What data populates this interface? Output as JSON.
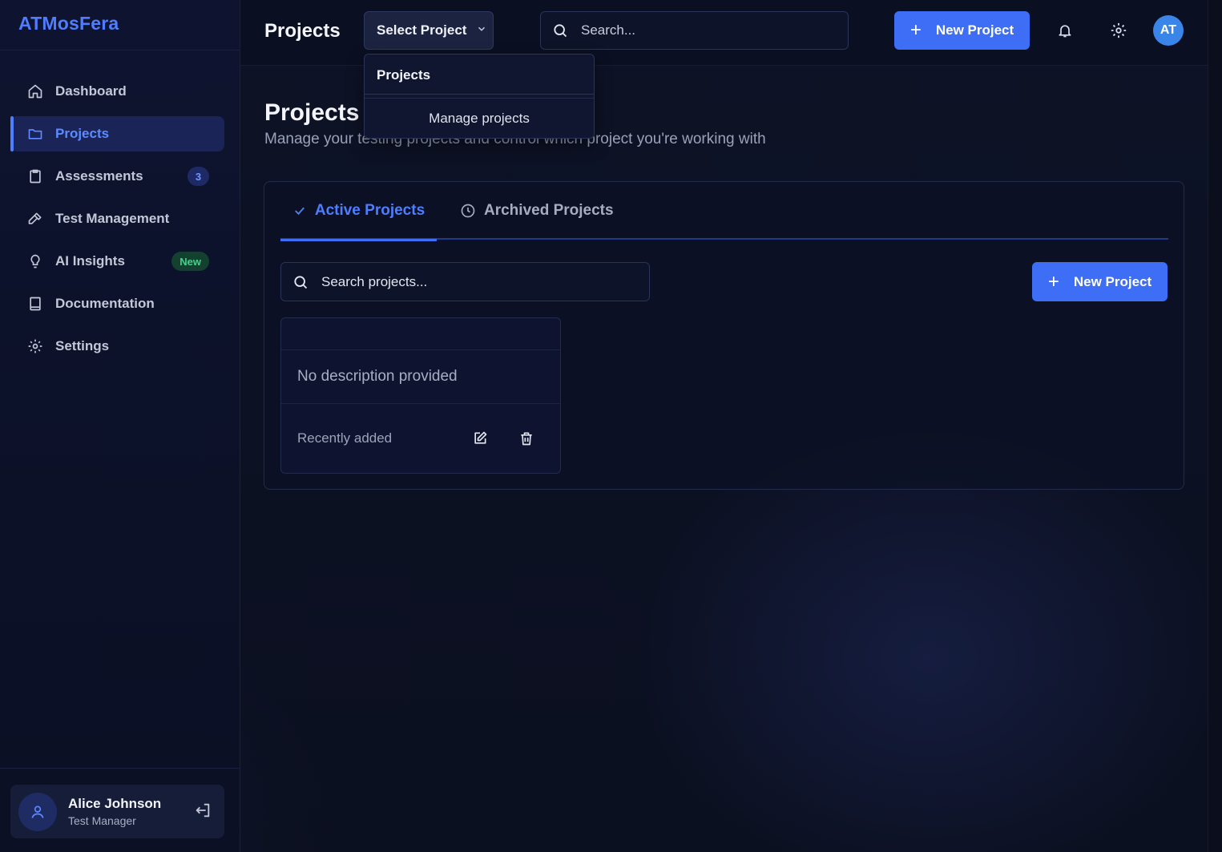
{
  "app": {
    "logo": "ATMosFera"
  },
  "sidebar": {
    "items": [
      {
        "label": "Dashboard",
        "icon": "home-icon"
      },
      {
        "label": "Projects",
        "icon": "folder-icon",
        "active": true
      },
      {
        "label": "Assessments",
        "icon": "clipboard-icon",
        "badge": "3"
      },
      {
        "label": "Test Management",
        "icon": "hammer-icon"
      },
      {
        "label": "AI Insights",
        "icon": "lightbulb-icon",
        "tag": "New"
      },
      {
        "label": "Documentation",
        "icon": "book-icon"
      },
      {
        "label": "Settings",
        "icon": "gear-icon"
      }
    ],
    "user": {
      "name": "Alice Johnson",
      "role": "Test Manager"
    }
  },
  "header": {
    "title": "Projects",
    "select_project": "Select Project",
    "search_placeholder": "Search...",
    "new_project": "New Project",
    "avatar_initials": "AT"
  },
  "dropdown": {
    "header": "Projects",
    "items": [
      "Manage projects"
    ]
  },
  "main": {
    "title": "Projects",
    "subtitle": "Manage your testing projects and control which project you're working with",
    "tabs": [
      {
        "label": "Active Projects",
        "active": true
      },
      {
        "label": "Archived Projects"
      }
    ],
    "search_placeholder": "Search projects...",
    "new_project": "New Project",
    "projects": [
      {
        "name": "",
        "description": "No description provided",
        "date": "Recently added"
      }
    ]
  },
  "colors": {
    "accent": "#3d6ef5",
    "background": "#0b1020",
    "new_badge": "#45d08b"
  }
}
